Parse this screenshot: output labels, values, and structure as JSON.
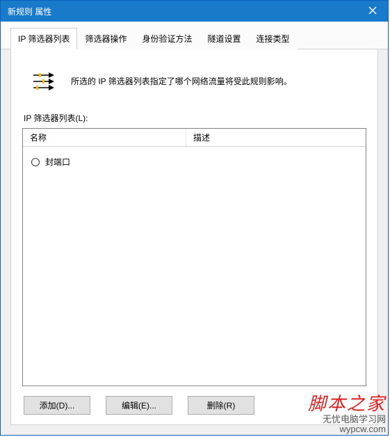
{
  "window": {
    "title": "新规则 属性"
  },
  "tabs": [
    {
      "label": "IP 筛选器列表",
      "active": true
    },
    {
      "label": "筛选器操作",
      "active": false
    },
    {
      "label": "身份验证方法",
      "active": false
    },
    {
      "label": "隧道设置",
      "active": false
    },
    {
      "label": "连接类型",
      "active": false
    }
  ],
  "info_text": "所选的 IP 筛选器列表指定了哪个网络流量将受此规则影响。",
  "list_label": "IP 筛选器列表(L):",
  "columns": {
    "name": "名称",
    "desc": "描述"
  },
  "rows": [
    {
      "name": "封端口",
      "desc": ""
    }
  ],
  "buttons": {
    "add": "添加(D)...",
    "edit": "编辑(E)...",
    "delete": "删除(R)"
  },
  "watermark": {
    "cn": "脚本之家",
    "en": "无忧电脑学习网",
    "url": "wypcw.com"
  }
}
